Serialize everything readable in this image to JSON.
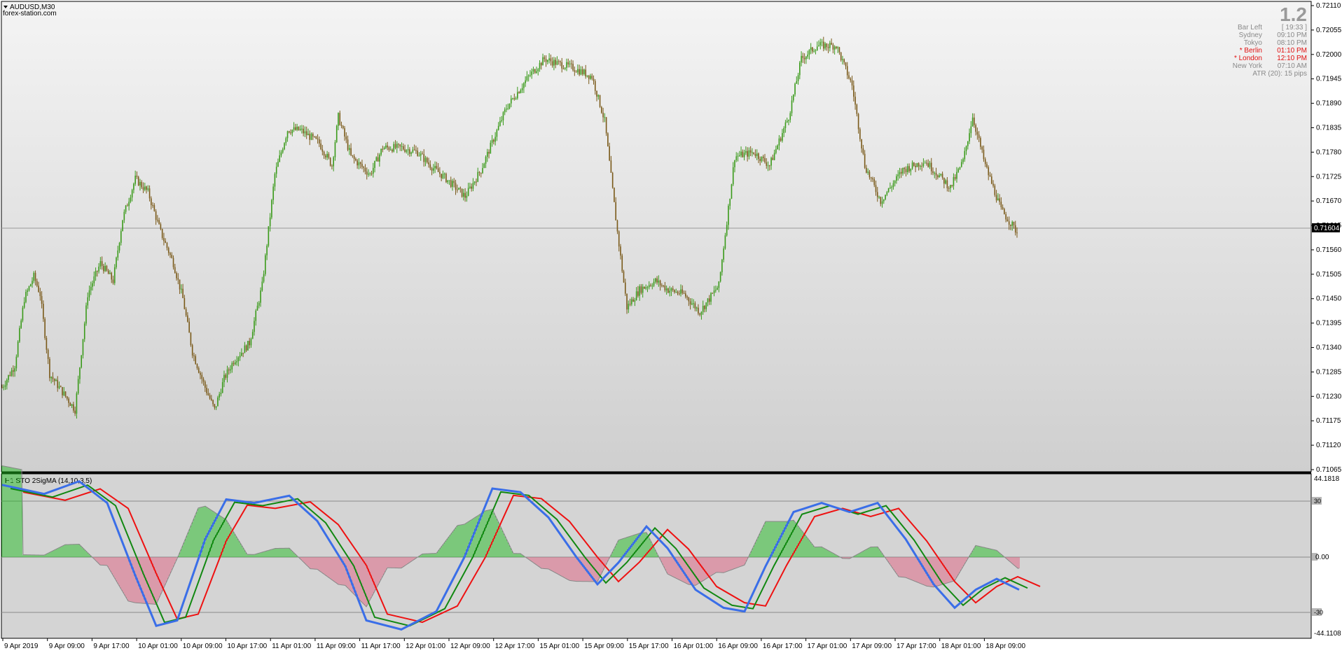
{
  "window": {
    "symbol": "AUDUSD,M30",
    "watermark": "forex-station.com"
  },
  "price_axis": {
    "labels": [
      "0.72110",
      "0.72055",
      "0.72000",
      "0.71945",
      "0.71890",
      "0.71835",
      "0.71780",
      "0.71725",
      "0.71670",
      "0.71615",
      "0.71560",
      "0.71505",
      "0.71450",
      "0.71395",
      "0.71340",
      "0.71285",
      "0.71230",
      "0.71175",
      "0.71120",
      "0.71065"
    ],
    "current_price": "0.71604",
    "min": 0.71065,
    "max": 0.7211
  },
  "info_panel": {
    "big_value": "1.2",
    "rows": [
      {
        "label": "Bar Left",
        "value": "[ 19:33 ]",
        "color": "#8a8a8a"
      },
      {
        "label": "Sydney",
        "value": "09:10 PM",
        "color": "#8a8a8a"
      },
      {
        "label": "Tokyo",
        "value": "08:10 PM",
        "color": "#8a8a8a"
      },
      {
        "label": "* Berlin",
        "value": "01:10 PM",
        "color": "#e01010"
      },
      {
        "label": "* London",
        "value": "12:10 PM",
        "color": "#e01010"
      },
      {
        "label": "New York",
        "value": "07:10 AM",
        "color": "#8a8a8a"
      }
    ],
    "atr": "ATR (20): 15 pips"
  },
  "indicator": {
    "title": "H1 STO 2SigMA (14,10,3,5)",
    "axis_top": "44.1818",
    "axis_bottom": "-44.1108",
    "level_high": "30",
    "level_zero": "0.00",
    "level_low": "-30",
    "min": -44.1108,
    "max": 44.1818
  },
  "time_axis": [
    "9 Apr 2019",
    "9 Apr 09:00",
    "9 Apr 17:00",
    "10 Apr 01:00",
    "10 Apr 09:00",
    "10 Apr 17:00",
    "11 Apr 01:00",
    "11 Apr 09:00",
    "11 Apr 17:00",
    "12 Apr 01:00",
    "12 Apr 09:00",
    "12 Apr 17:00",
    "15 Apr 01:00",
    "15 Apr 09:00",
    "15 Apr 17:00",
    "16 Apr 01:00",
    "16 Apr 09:00",
    "16 Apr 17:00",
    "17 Apr 01:00",
    "17 Apr 09:00",
    "17 Apr 17:00",
    "18 Apr 01:00",
    "18 Apr 09:00"
  ],
  "colors": {
    "bull_candle": "#3a9a1a",
    "bear_candle": "#7a5a1a",
    "hist_positive": "#22bb22",
    "hist_negative": "#e06080",
    "line_blue": "#3a6ee8",
    "line_green": "#118811",
    "line_red": "#ee1111"
  },
  "chart_data": {
    "type": "candlestick",
    "price_path": [
      [
        0,
        0.7125
      ],
      [
        8,
        0.713
      ],
      [
        14,
        0.7145
      ],
      [
        20,
        0.715
      ],
      [
        24,
        0.7146
      ],
      [
        30,
        0.7128
      ],
      [
        38,
        0.7124
      ],
      [
        46,
        0.712
      ],
      [
        54,
        0.7146
      ],
      [
        62,
        0.7153
      ],
      [
        70,
        0.7149
      ],
      [
        76,
        0.7163
      ],
      [
        84,
        0.7172
      ],
      [
        92,
        0.7169
      ],
      [
        100,
        0.716
      ],
      [
        108,
        0.7153
      ],
      [
        114,
        0.7145
      ],
      [
        120,
        0.7133
      ],
      [
        128,
        0.7125
      ],
      [
        134,
        0.712
      ],
      [
        140,
        0.7127
      ],
      [
        146,
        0.7131
      ],
      [
        156,
        0.7135
      ],
      [
        164,
        0.7148
      ],
      [
        172,
        0.7173
      ],
      [
        180,
        0.7183
      ],
      [
        188,
        0.7183
      ],
      [
        200,
        0.718
      ],
      [
        208,
        0.7175
      ],
      [
        212,
        0.7186
      ],
      [
        220,
        0.7177
      ],
      [
        232,
        0.7173
      ],
      [
        240,
        0.7179
      ],
      [
        252,
        0.7179
      ],
      [
        262,
        0.7178
      ],
      [
        270,
        0.7175
      ],
      [
        280,
        0.7172
      ],
      [
        292,
        0.7168
      ],
      [
        302,
        0.7174
      ],
      [
        318,
        0.7188
      ],
      [
        332,
        0.7195
      ],
      [
        342,
        0.7199
      ],
      [
        350,
        0.7198
      ],
      [
        360,
        0.7197
      ],
      [
        372,
        0.7195
      ],
      [
        380,
        0.7185
      ],
      [
        388,
        0.716
      ],
      [
        394,
        0.7143
      ],
      [
        402,
        0.7147
      ],
      [
        412,
        0.7149
      ],
      [
        420,
        0.7147
      ],
      [
        430,
        0.7146
      ],
      [
        440,
        0.7142
      ],
      [
        452,
        0.7148
      ],
      [
        462,
        0.7177
      ],
      [
        474,
        0.7178
      ],
      [
        484,
        0.7175
      ],
      [
        496,
        0.7186
      ],
      [
        504,
        0.7199
      ],
      [
        514,
        0.7202
      ],
      [
        526,
        0.7202
      ],
      [
        536,
        0.7193
      ],
      [
        544,
        0.7175
      ],
      [
        554,
        0.7167
      ],
      [
        568,
        0.7174
      ],
      [
        582,
        0.7176
      ],
      [
        598,
        0.717
      ],
      [
        606,
        0.7176
      ],
      [
        612,
        0.7186
      ],
      [
        620,
        0.7175
      ],
      [
        630,
        0.7165
      ],
      [
        640,
        0.716
      ]
    ]
  }
}
